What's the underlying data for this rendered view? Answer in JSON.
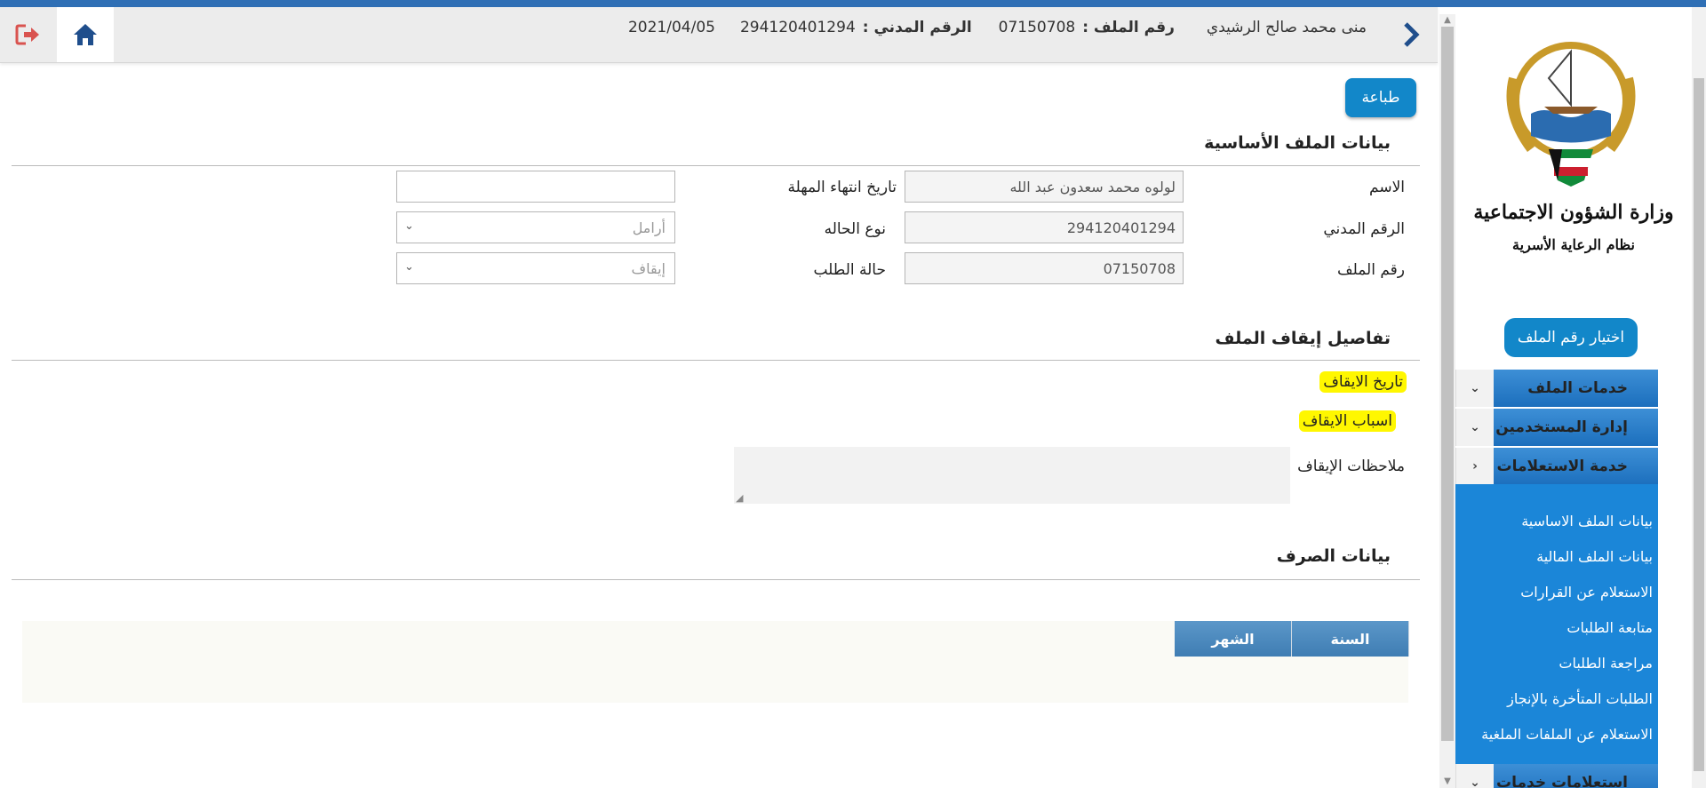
{
  "header": {
    "user_name": "منى محمد صالح الرشيدي",
    "file_no_label": "رقم الملف :",
    "file_no_value": "07150708",
    "civil_id_label": "الرقم المدني :",
    "civil_id_value": "294120401294",
    "date": "2021/04/05"
  },
  "sidebar": {
    "ministry_name": "وزارة الشؤون الاجتماعية",
    "system_name": "نظام الرعاية الأسرية",
    "choose_file_button": "اختيار رقم الملف",
    "menus": [
      {
        "label": "خدمات الملف"
      },
      {
        "label": "إدارة المستخدمين"
      },
      {
        "label": "خدمة الاستعلامات"
      },
      {
        "label": "استعلامات خدمات الربط"
      }
    ],
    "submenu_items": [
      "بيانات الملف الاساسية",
      "بيانات الملف المالية",
      "الاستعلام عن القرارات",
      "متابعة الطلبات",
      "مراجعة الطلبات",
      "الطلبات المتأخرة بالإنجاز",
      "الاستعلام عن الملفات الملغية"
    ]
  },
  "main": {
    "print_button": "طباعة",
    "basic": {
      "title": "بيانات الملف الأساسية",
      "name_label": "الاسم",
      "name_value": "لولوه محمد سعدون عبد الله",
      "civil_label": "الرقم المدني",
      "civil_value": "294120401294",
      "file_label": "رقم الملف",
      "file_value": "07150708",
      "grace_end_label": "تاريخ انتهاء المهلة",
      "grace_end_value": "",
      "case_type_label": "نوع الحاله",
      "case_type_value": "أرامل",
      "request_status_label": "حالة الطلب",
      "request_status_value": "إيقاف"
    },
    "stop": {
      "title": "تفاصيل إيقاف الملف",
      "date_label": "تاريخ الايقاف",
      "reasons_label": "اسباب الايقاف",
      "notes_label": "ملاحظات الإيقاف"
    },
    "disburse": {
      "title": "بيانات الصرف",
      "columns": [
        "السنة",
        "الشهر"
      ]
    }
  },
  "colors": {
    "accent": "#1287c9",
    "menu_blue": "#1c6fbd",
    "highlight": "#fff700",
    "top_line": "#2f6fb5"
  }
}
